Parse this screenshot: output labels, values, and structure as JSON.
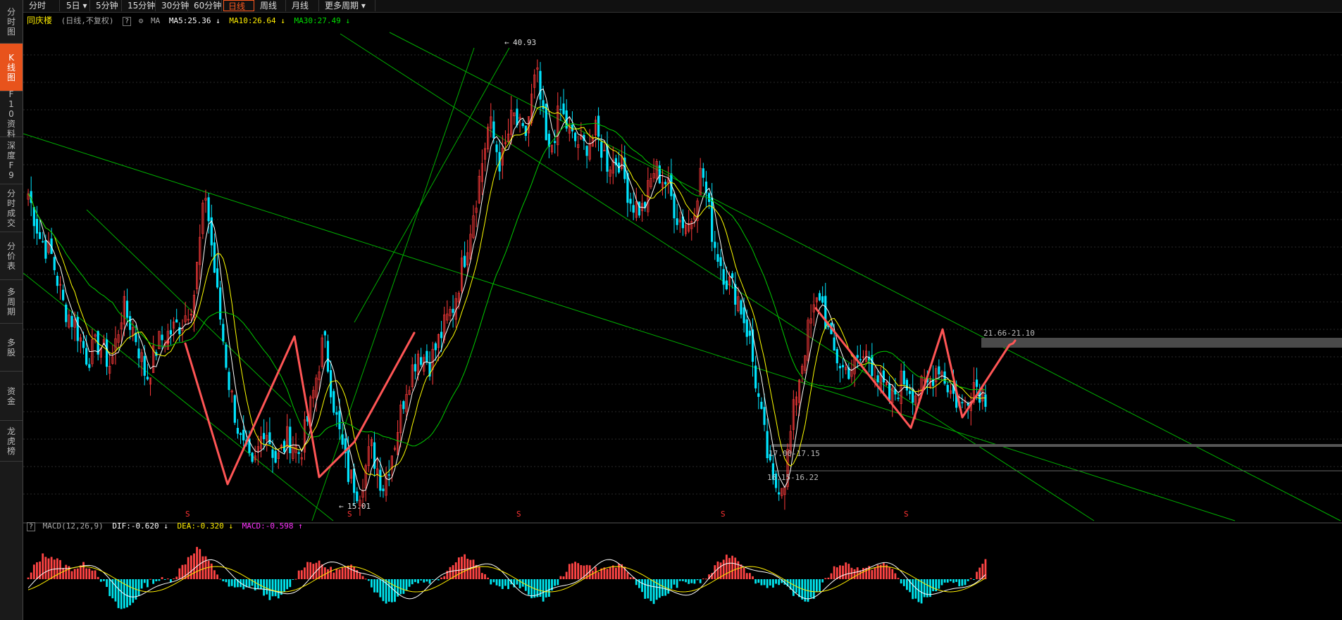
{
  "sidebar": {
    "tabs": [
      {
        "label": "分时图",
        "active": false
      },
      {
        "label": "K线图",
        "active": true
      },
      {
        "label": "F10资料",
        "active": false
      },
      {
        "label": "深度F9",
        "active": false
      },
      {
        "label": "分时成交",
        "active": false
      },
      {
        "label": "分价表",
        "active": false
      },
      {
        "label": "多周期",
        "active": false
      },
      {
        "label": "多股",
        "active": false
      },
      {
        "label": "资金",
        "active": false
      },
      {
        "label": "龙虎榜",
        "active": false
      }
    ]
  },
  "topbar": {
    "periods": [
      {
        "label": "分时"
      },
      {
        "label": "5日 ▾"
      },
      {
        "label": "5分钟"
      },
      {
        "label": "15分钟"
      },
      {
        "label": "30分钟"
      },
      {
        "label": "60分钟"
      },
      {
        "label": "日线",
        "active": true
      },
      {
        "label": "周线"
      },
      {
        "label": "月线"
      },
      {
        "label": "更多周期 ▾"
      }
    ]
  },
  "header": {
    "stock_name": "同庆楼",
    "mode": "(日线,不复权)",
    "help": "?",
    "indicator": "MA",
    "ma5": "MA5:25.36",
    "ma5_arrow": "↓",
    "ma10": "MA10:26.64",
    "ma10_arrow": "↓",
    "ma30": "MA30:27.49",
    "ma30_arrow": "↓"
  },
  "macd_header": {
    "help": "?",
    "name": "MACD(12,26,9)",
    "dif": "DIF:-0.620",
    "dif_arrow": "↓",
    "dea": "DEA:-0.320",
    "dea_arrow": "↓",
    "macd": "MACD:-0.598",
    "macd_arrow": "↑"
  },
  "annotations": {
    "high": "40.93",
    "low": "15.01",
    "zone1": "21.66-21.10",
    "zone2": "17.00-17.15",
    "zone3": "16.15-16.22",
    "signal_marker": "S"
  },
  "colors": {
    "accent": "#e8531c",
    "ma5": "#ffffff",
    "ma10": "#ffff00",
    "ma30": "#00cc00",
    "candle_up": "#ff3b3b",
    "candle_down": "#00e5ff",
    "trendline": "#00b000",
    "pattern": "#ff5555",
    "macd_pos": "#ff4444",
    "macd_neg": "#00e5ee",
    "macd_purple": "#ff00ff"
  },
  "chart_data": {
    "type": "line",
    "title": "同庆楼",
    "series": [
      {
        "name": "Close",
        "values": [
          33.6,
          31,
          29.9,
          27,
          25.9,
          24,
          24.9,
          23.5,
          27,
          25.5,
          22.8,
          24.9,
          25.5,
          26.1,
          27.6,
          33.7,
          27.6,
          22.5,
          19,
          17.3,
          20.2,
          17.9,
          19.4,
          18.4,
          21.5,
          25.2,
          20.7,
          17.3,
          16.2,
          18.8,
          16.5,
          19.1,
          22.4,
          24.4,
          23.7,
          25.5,
          27.1,
          30.2,
          33.8,
          37.8,
          35.2,
          38.2,
          36.7,
          40.7,
          35.6,
          38.5,
          36.8,
          36.3,
          37.1,
          35.4,
          35.6,
          33.1,
          32.6,
          35.1,
          34.2,
          32.1,
          31.8,
          35.1,
          30.8,
          28.7,
          27.7,
          25.2,
          20.6,
          16.4,
          17,
          22.1,
          25.6,
          27.8,
          24.5,
          23.3,
          23.5,
          24.3,
          22.6,
          21.5,
          22.8,
          22,
          22.3,
          23.7,
          22.1,
          21.1,
          22.6,
          21.8
        ]
      }
    ],
    "ylim": [
      14.5,
      42.5
    ],
    "annotations": [
      "40.93",
      "15.01",
      "21.66-21.10",
      "17.00-17.15",
      "16.15-16.22"
    ],
    "macd": {
      "dif": -0.62,
      "dea": -0.32,
      "macd": -0.598
    }
  }
}
